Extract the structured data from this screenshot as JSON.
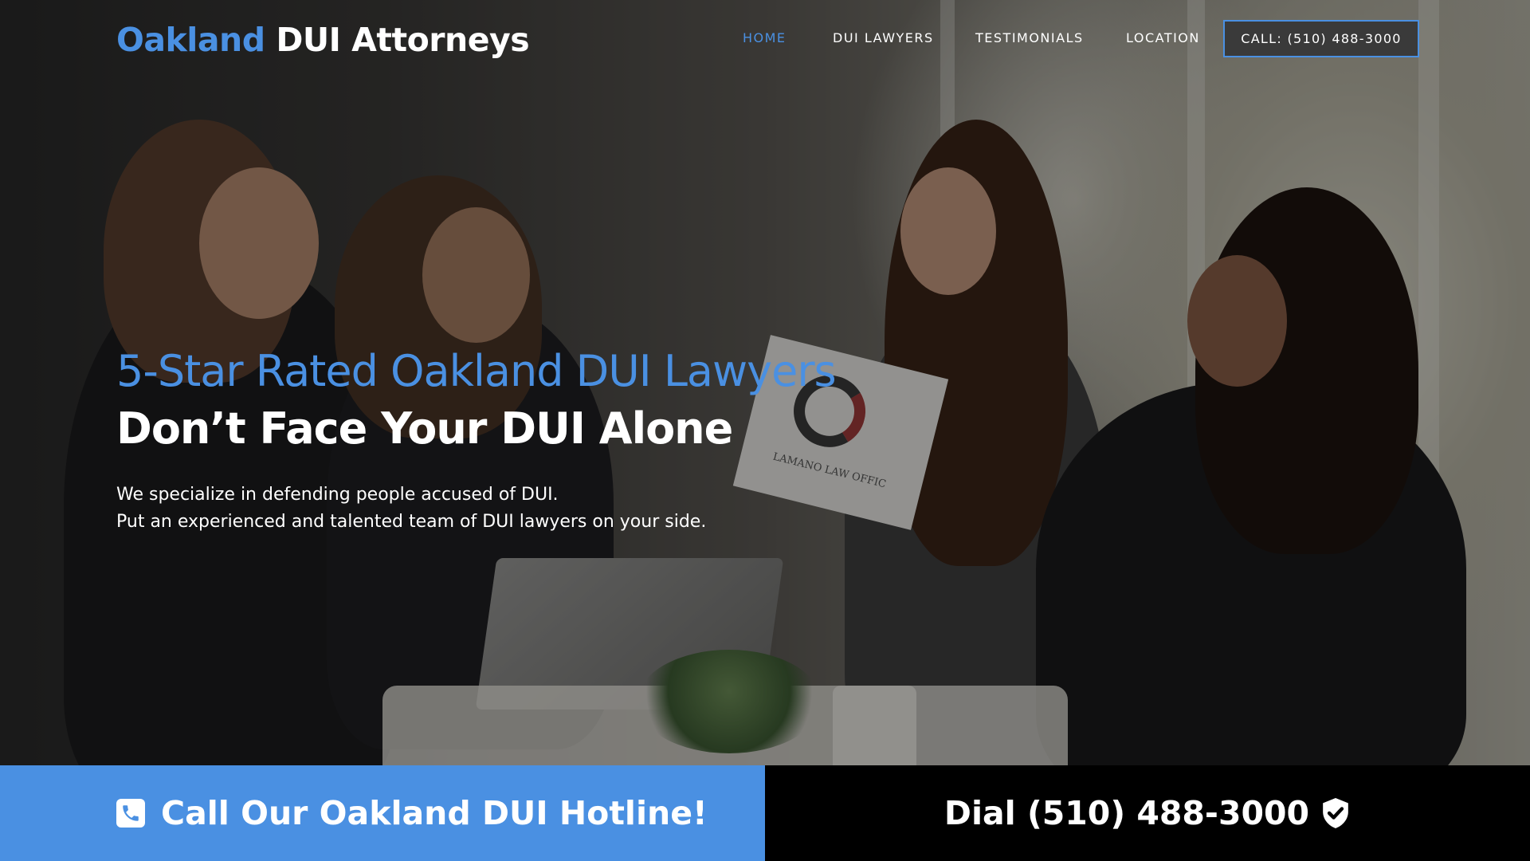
{
  "brand": {
    "accent": "Oakland",
    "rest": "DUI Attorneys"
  },
  "nav": {
    "items": [
      {
        "label": "HOME"
      },
      {
        "label": "DUI LAWYERS"
      },
      {
        "label": "TESTIMONIALS"
      },
      {
        "label": "LOCATION"
      }
    ],
    "call_label": "CALL: (510) 488-3000"
  },
  "hero": {
    "headline_accent": "5-Star Rated Oakland DUI Lawyers",
    "headline": "Don’t Face Your DUI Alone",
    "sub_1": "We specialize in defending people accused of DUI.",
    "sub_2": "Put an experienced and talented team of DUI lawyers on your side.",
    "paper_text": "LAMANO LAW OFFIC"
  },
  "cta": {
    "left_label": "Call Our Oakland DUI Hotline!",
    "right_label": "Dial (510) 488-3000",
    "left_icon": "phone-icon",
    "right_icon": "shield-check-icon"
  },
  "colors": {
    "accent": "#4a90e2",
    "dark": "#000000",
    "nav_button": "#3a3a3a"
  }
}
